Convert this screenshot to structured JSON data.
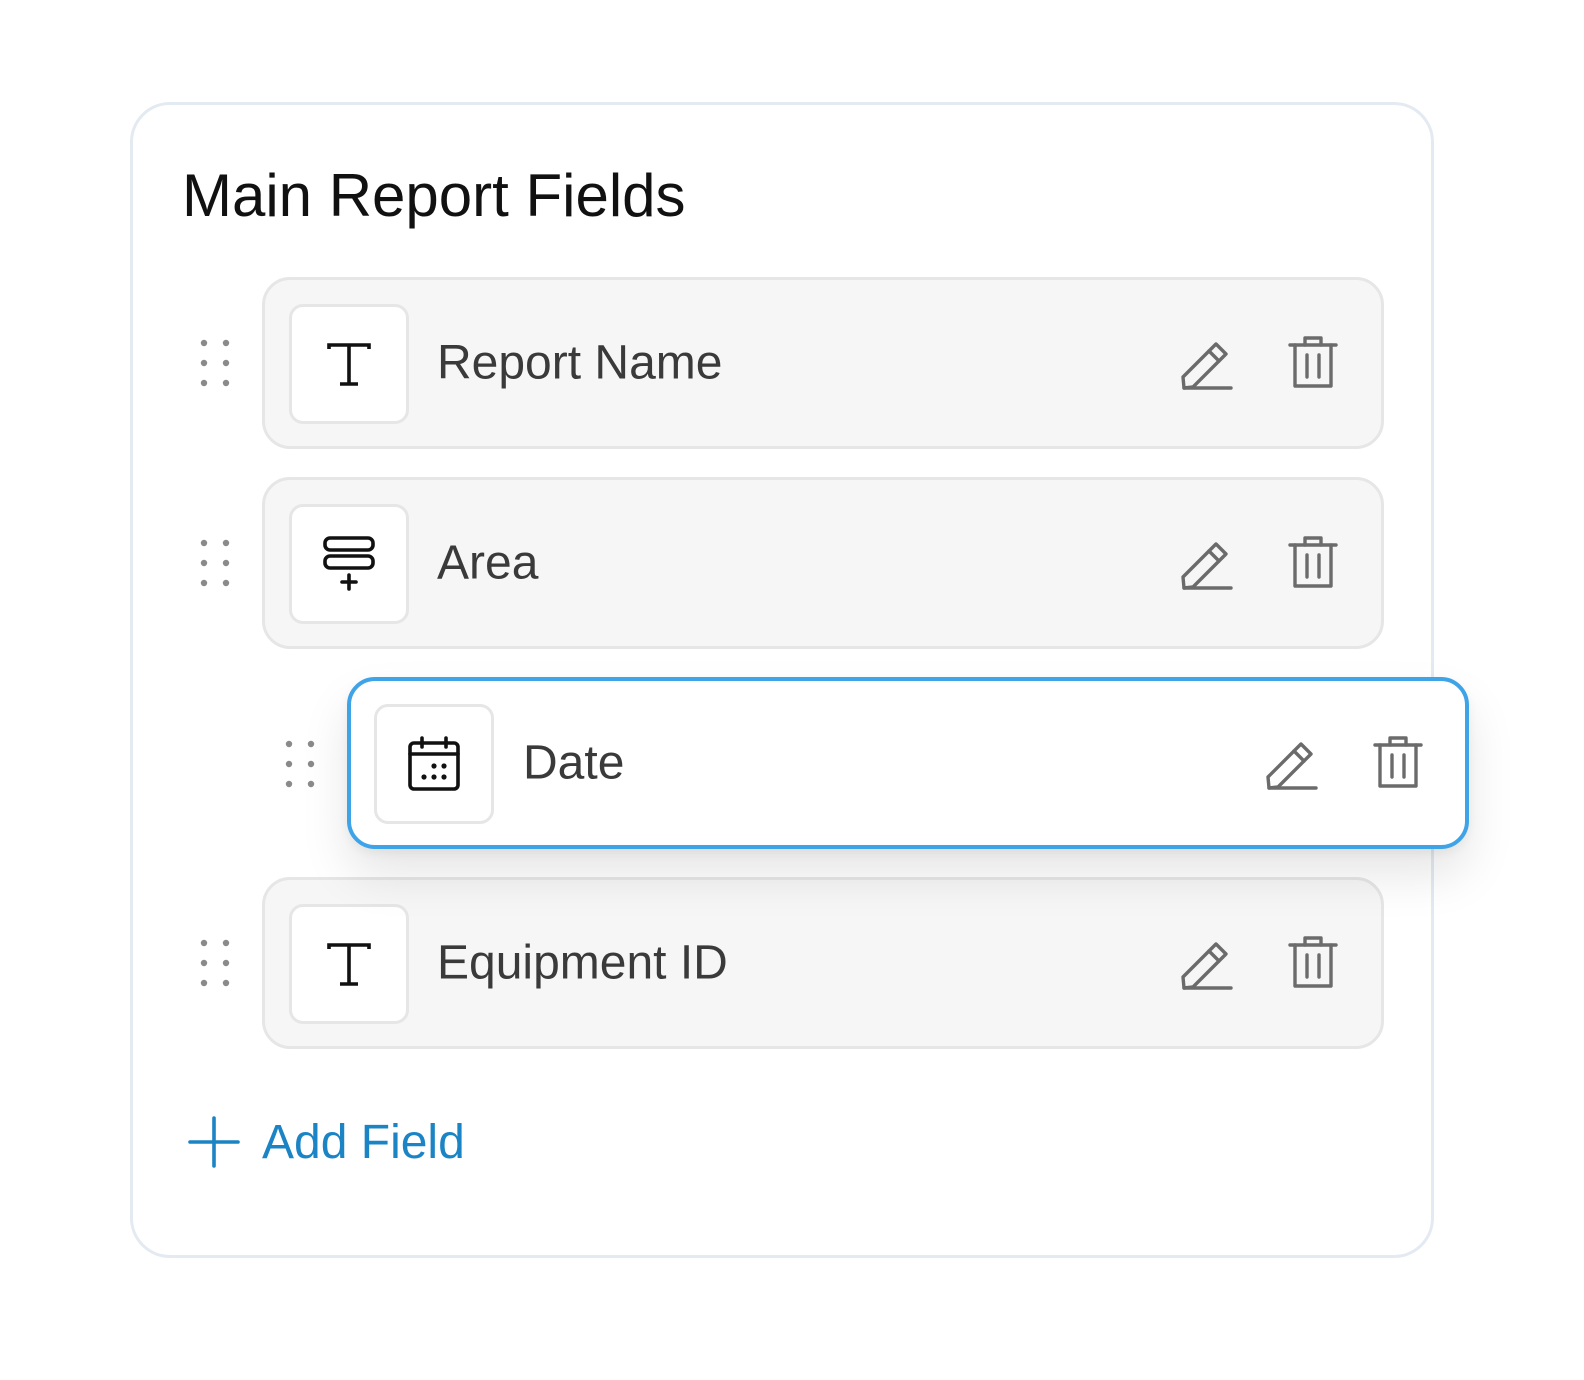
{
  "card": {
    "title": "Main Report Fields"
  },
  "fields": [
    {
      "label": "Report Name",
      "type_icon": "text-type-icon",
      "state": "idle"
    },
    {
      "label": "Area",
      "type_icon": "dropdown-list-icon",
      "state": "idle"
    },
    {
      "label": "Date",
      "type_icon": "calendar-icon",
      "state": "dragging"
    },
    {
      "label": "Equipment ID",
      "type_icon": "text-type-icon",
      "state": "idle"
    }
  ],
  "row_actions": [
    "pencil-icon",
    "trash-icon"
  ],
  "add_field": {
    "label": "Add Field",
    "icon": "plus-icon"
  },
  "colors": {
    "accent": "#1b84c4",
    "drag_border": "#3fa3e8",
    "row_background": "#f6f6f6",
    "row_border": "#e6e6e6",
    "card_border": "#e3eaf1",
    "icon_gray": "#6b6b6b"
  }
}
